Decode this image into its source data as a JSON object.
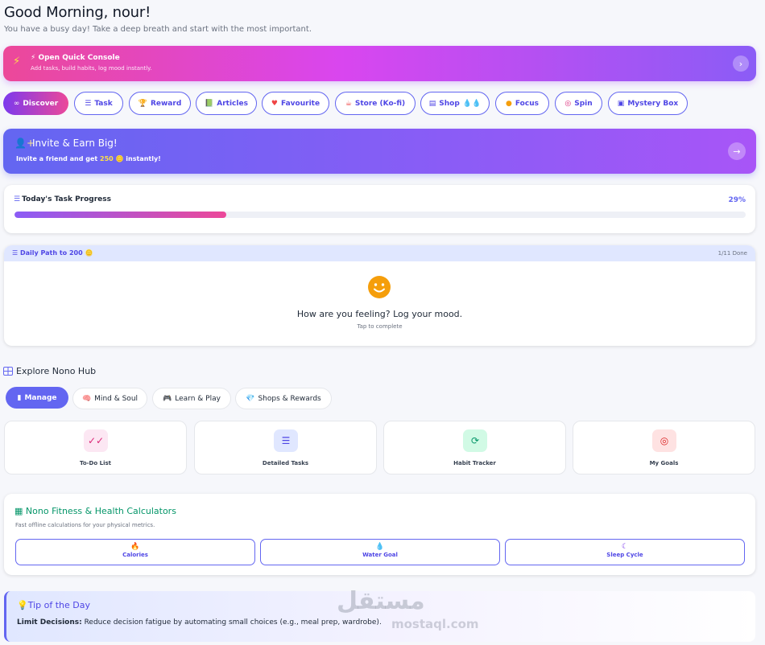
{
  "greeting": {
    "title": "Good Morning, nour!",
    "subtitle": "You have a busy day! Take a deep breath and start with the most important."
  },
  "quick_console": {
    "icon": "lightning-icon",
    "title": "⚡ Open Quick Console",
    "subtitle": "Add tasks, build habits, log mood instantly.",
    "action_icon": "chevron-right-icon"
  },
  "nav_pills": [
    {
      "label": "Discover",
      "icon": "∞",
      "active": true
    },
    {
      "label": "Task",
      "icon": "☰"
    },
    {
      "label": "Reward",
      "icon": "🏆"
    },
    {
      "label": "Articles",
      "icon": "📗"
    },
    {
      "label": "Favourite",
      "icon": "♥"
    },
    {
      "label": "Store (Ko-fi)",
      "icon": "☕"
    },
    {
      "label": "Shop",
      "icon": "▤",
      "suffix": "💧💧"
    },
    {
      "label": "Focus",
      "icon": "●"
    },
    {
      "label": "Spin",
      "icon": "◎"
    },
    {
      "label": "Mystery Box",
      "icon": "▣"
    }
  ],
  "invite": {
    "title": "Invite & Earn Big!",
    "text_before": "Invite a friend and get ",
    "amount": "250",
    "coin": "🪙",
    "text_after": " instantly!"
  },
  "progress": {
    "title": "Today's Task Progress",
    "percent_label": "29%",
    "value": 0.29
  },
  "daily_path": {
    "title": "Daily Path to 200",
    "done": "1/11 Done",
    "question": "How are you feeling? Log your mood.",
    "hint": "Tap to complete"
  },
  "hub": {
    "title": "Explore Nono Hub",
    "tabs": [
      {
        "label": "Manage",
        "icon": "▮",
        "active": true
      },
      {
        "label": "Mind & Soul",
        "icon": "🧠"
      },
      {
        "label": "Learn & Play",
        "icon": "🎮"
      },
      {
        "label": "Shops & Rewards",
        "icon": "💎"
      }
    ],
    "tiles": [
      {
        "label": "To-Do List",
        "icon": "✓✓",
        "bg": "#fce7f3",
        "fg": "#db2777"
      },
      {
        "label": "Detailed Tasks",
        "icon": "☰",
        "bg": "#e0e7ff",
        "fg": "#4f46e5"
      },
      {
        "label": "Habit Tracker",
        "icon": "⟳",
        "bg": "#d1fae5",
        "fg": "#059669"
      },
      {
        "label": "My Goals",
        "icon": "◎",
        "bg": "#fee2e2",
        "fg": "#dc2626"
      }
    ]
  },
  "calculators": {
    "title": "Nono Fitness & Health Calculators",
    "subtitle": "Fast offline calculations for your physical metrics.",
    "buttons": [
      {
        "label": "Calories",
        "icon": "🔥"
      },
      {
        "label": "Water Goal",
        "icon": "💧"
      },
      {
        "label": "Sleep Cycle",
        "icon": "☾"
      }
    ]
  },
  "tip": {
    "title": "Tip of the Day",
    "label": "Limit Decisions:",
    "text": " Reduce decision fatigue by automating small choices (e.g., meal prep, wardrobe)."
  },
  "watermark": {
    "arabic": "مستقل",
    "latin": "mostaql.com"
  },
  "colors": {
    "accent": "#6366f1",
    "pink": "#ec4899",
    "purple": "#8b5cf6",
    "green": "#059669"
  }
}
